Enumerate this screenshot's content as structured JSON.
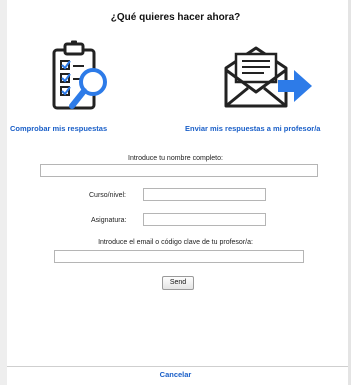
{
  "dialog": {
    "title": "¿Qué quieres hacer ahora?"
  },
  "actions": {
    "check_label": "Comprobar mis respuestas",
    "check_icon": "clipboard-magnifier-icon",
    "send_label": "Enviar mis respuestas a mi profesor/a",
    "send_icon": "envelope-arrow-icon"
  },
  "form": {
    "name_label": "Introduce tu nombre completo:",
    "name_value": "",
    "course_label": "Curso/nivel:",
    "course_value": "",
    "subject_label": "Asignatura:",
    "subject_value": "",
    "email_label": "Introduce el email o código clave de tu profesor/a:",
    "email_value": "",
    "send_button": "Send"
  },
  "footer": {
    "cancel_label": "Cancelar"
  },
  "colors": {
    "link": "#1a5fc8",
    "icon_blue": "#2d7be8",
    "icon_dark": "#222222"
  }
}
